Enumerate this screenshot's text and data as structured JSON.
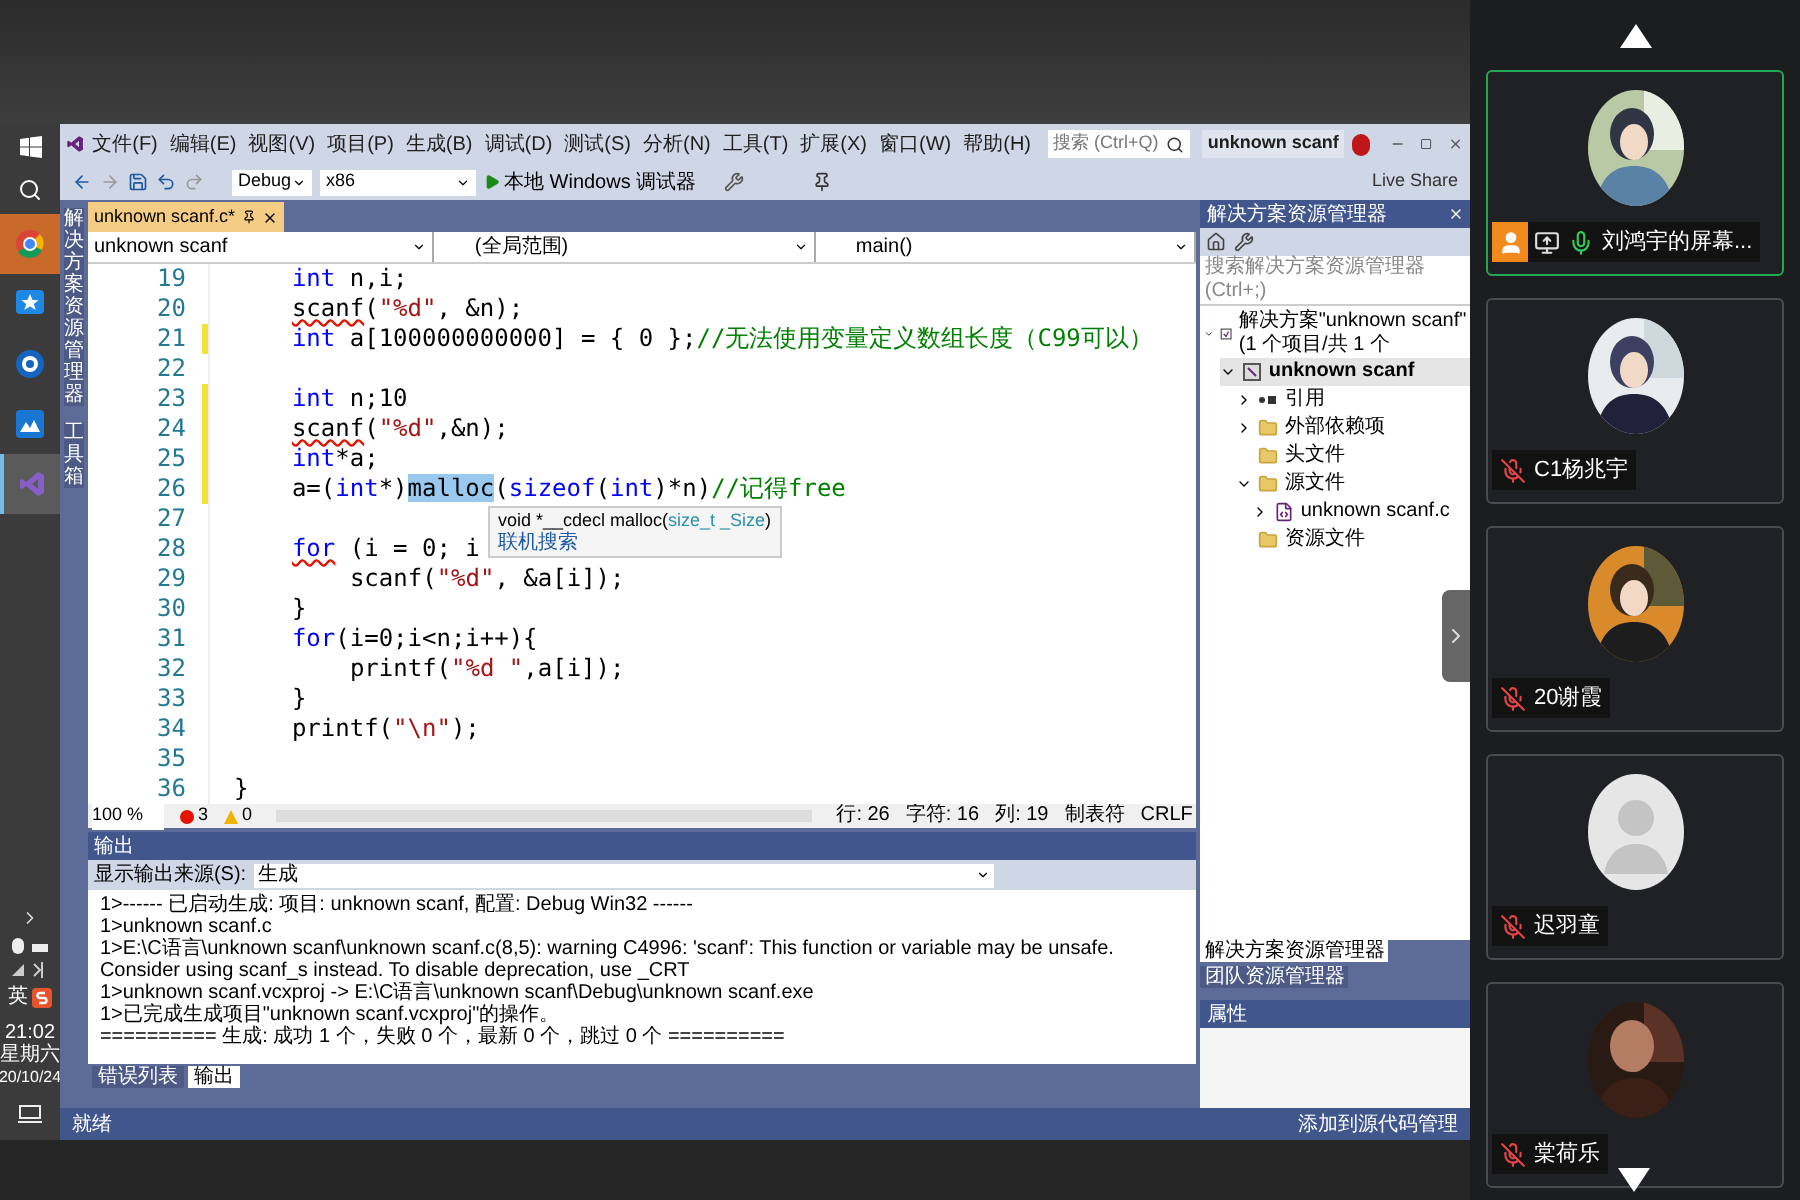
{
  "taskbar": {
    "ime": "英",
    "time": "21:02",
    "day": "星期六",
    "date": "20/10/24",
    "apps": [
      {
        "kind": "chrome",
        "selected": false
      },
      {
        "kind": "star",
        "selected": false
      },
      {
        "kind": "ring",
        "selected": false
      },
      {
        "kind": "mountain",
        "selected": false
      },
      {
        "kind": "vs",
        "selected": true
      }
    ]
  },
  "vs": {
    "menu": [
      "文件(F)",
      "编辑(E)",
      "视图(V)",
      "项目(P)",
      "生成(B)",
      "调试(D)",
      "测试(S)",
      "分析(N)",
      "工具(T)",
      "扩展(X)",
      "窗口(W)",
      "帮助(H)"
    ],
    "search": {
      "placeholder": "搜索 (Ctrl+Q)"
    },
    "title": "unknown scanf",
    "toolbar": {
      "config": "Debug",
      "platform": "x86",
      "run": "本地 Windows 调试器",
      "live_share": "Live Share"
    },
    "side_tabs": [
      "解决方案资源管理器",
      "工具箱"
    ],
    "doc_tab": {
      "label": "unknown scanf.c*"
    },
    "nav": [
      "unknown scanf",
      "(全局范围)",
      "main()"
    ],
    "code": [
      {
        "number": "19",
        "changed": false,
        "kind": "body",
        "tokens": [
          {
            "kind": "kw",
            "text": "int"
          },
          {
            "kind": "plain",
            "text": " n,i;"
          }
        ]
      },
      {
        "number": "20",
        "changed": false,
        "kind": "body",
        "tokens": [
          {
            "kind": "err",
            "text": "scanf"
          },
          {
            "kind": "plain",
            "text": "("
          },
          {
            "kind": "str",
            "text": "\"%d\""
          },
          {
            "kind": "plain",
            "text": ", &n);"
          }
        ]
      },
      {
        "number": "21",
        "changed": true,
        "kind": "body",
        "tokens": [
          {
            "kind": "kw",
            "text": "int"
          },
          {
            "kind": "plain",
            "text": " a[100000000000] = { 0 };"
          },
          {
            "kind": "cm",
            "text": "//无法使用变量定义数组长度（C99可以）"
          }
        ]
      },
      {
        "number": "22",
        "changed": false,
        "kind": "blank"
      },
      {
        "number": "23",
        "changed": true,
        "kind": "body",
        "tokens": [
          {
            "kind": "kw",
            "text": "int"
          },
          {
            "kind": "plain",
            "text": " n;10"
          }
        ]
      },
      {
        "number": "24",
        "changed": true,
        "kind": "body",
        "tokens": [
          {
            "kind": "err",
            "text": "scanf"
          },
          {
            "kind": "plain",
            "text": "("
          },
          {
            "kind": "str",
            "text": "\"%d\""
          },
          {
            "kind": "plain",
            "text": ",&n);"
          }
        ]
      },
      {
        "number": "25",
        "changed": true,
        "kind": "body",
        "tokens": [
          {
            "kind": "kw",
            "text": "int"
          },
          {
            "kind": "plain",
            "text": "*a;"
          }
        ]
      },
      {
        "number": "26",
        "changed": true,
        "kind": "body",
        "tokens": [
          {
            "kind": "plain",
            "text": "a=("
          },
          {
            "kind": "kw",
            "text": "int"
          },
          {
            "kind": "plain",
            "text": "*)"
          },
          {
            "kind": "hl",
            "text": "malloc"
          },
          {
            "kind": "plain",
            "text": "("
          },
          {
            "kind": "kw",
            "text": "sizeof"
          },
          {
            "kind": "plain",
            "text": "("
          },
          {
            "kind": "kw",
            "text": "int"
          },
          {
            "kind": "plain",
            "text": ")*n)"
          },
          {
            "kind": "cm",
            "text": "//记得free"
          }
        ]
      },
      {
        "number": "27",
        "changed": false,
        "kind": "blank"
      },
      {
        "number": "28",
        "changed": false,
        "kind": "body",
        "tokens": [
          {
            "kind": "kwerr",
            "text": "for"
          },
          {
            "kind": "plain",
            "text": " (i = 0; i"
          }
        ]
      },
      {
        "number": "29",
        "changed": false,
        "kind": "nested",
        "tokens": [
          {
            "kind": "plain",
            "text": "scanf("
          },
          {
            "kind": "str",
            "text": "\"%d\""
          },
          {
            "kind": "plain",
            "text": ", &a[i]);"
          }
        ]
      },
      {
        "number": "30",
        "changed": false,
        "kind": "body",
        "tokens": [
          {
            "kind": "plain",
            "text": "}"
          }
        ]
      },
      {
        "number": "31",
        "changed": false,
        "kind": "body",
        "tokens": [
          {
            "kind": "kw",
            "text": "for"
          },
          {
            "kind": "plain",
            "text": "(i=0;i<n;i++){"
          }
        ]
      },
      {
        "number": "32",
        "changed": false,
        "kind": "nested",
        "tokens": [
          {
            "kind": "plain",
            "text": "printf("
          },
          {
            "kind": "str",
            "text": "\"%d \""
          },
          {
            "kind": "plain",
            "text": ",a[i]);"
          }
        ]
      },
      {
        "number": "33",
        "changed": false,
        "kind": "body",
        "tokens": [
          {
            "kind": "plain",
            "text": "}"
          }
        ]
      },
      {
        "number": "34",
        "changed": false,
        "kind": "body",
        "tokens": [
          {
            "kind": "plain",
            "text": "printf("
          },
          {
            "kind": "str",
            "text": "\"\\n\""
          },
          {
            "kind": "plain",
            "text": ");"
          }
        ]
      },
      {
        "number": "35",
        "changed": false,
        "kind": "blank"
      },
      {
        "number": "36",
        "changed": false,
        "kind": "top",
        "tokens": [
          {
            "kind": "plain",
            "text": "}"
          }
        ]
      }
    ],
    "tooltip": {
      "prefix": "void *__cdecl malloc(",
      "param": "size_t _Size",
      "suffix": ")",
      "link": "联机搜索"
    },
    "editor_status": {
      "zoom": "100 %",
      "errors": "3",
      "warnings": "0",
      "position": [
        "行: 26",
        "字符: 16",
        "列: 19",
        "制表符",
        "CRLF"
      ]
    },
    "output": {
      "title": "输出",
      "source_label": "显示输出来源(S):",
      "source": "生成",
      "lines": [
        "1>------ 已启动生成: 项目: unknown scanf, 配置: Debug Win32 ------",
        "1>unknown scanf.c",
        "1>E:\\C语言\\unknown scanf\\unknown scanf.c(8,5): warning C4996: 'scanf': This function or variable may be unsafe. Consider using scanf_s instead. To disable deprecation, use _CRT",
        "1>unknown scanf.vcxproj -> E:\\C语言\\unknown scanf\\Debug\\unknown scanf.exe",
        "1>已完成生成项目\"unknown scanf.vcxproj\"的操作。",
        "========== 生成: 成功 1 个，失败 0 个，最新 0 个，跳过 0 个 =========="
      ],
      "tabs": [
        {
          "label": "错误列表",
          "selected": false
        },
        {
          "label": "输出",
          "selected": true
        }
      ]
    },
    "status": {
      "text": "就绪",
      "scm": "添加到源代码管理"
    },
    "solution": {
      "title": "解决方案资源管理器",
      "search": {
        "placeholder": "搜索解决方案资源管理器(Ctrl+;)"
      },
      "tree": [
        {
          "label": "解决方案\"unknown scanf\"(1 个项目/共 1 个",
          "kind": "solution",
          "expanded": true,
          "children": [
            {
              "label": "unknown scanf",
              "kind": "project",
              "expanded": true,
              "children": [
                {
                  "label": "引用",
                  "kind": "refs",
                  "expanded": false
                },
                {
                  "label": "外部依赖项",
                  "kind": "folder",
                  "expanded": false
                },
                {
                  "label": "头文件",
                  "kind": "folder"
                },
                {
                  "label": "源文件",
                  "kind": "folder",
                  "expanded": true,
                  "children": [
                    {
                      "label": "unknown scanf.c",
                      "kind": "file",
                      "expanded": false
                    }
                  ]
                },
                {
                  "label": "资源文件",
                  "kind": "folder"
                }
              ]
            }
          ]
        }
      ],
      "tabs": [
        {
          "label": "解决方案资源管理器",
          "selected": true
        },
        {
          "label": "团队资源管理器",
          "selected": false
        }
      ],
      "properties": "属性"
    }
  },
  "participants": [
    {
      "name": "刘鸿宇的屏幕...",
      "kind": "picture",
      "muted": false,
      "sharing": true,
      "selected": true
    },
    {
      "name": "C1杨兆宇",
      "kind": "picture",
      "muted": true,
      "sharing": false,
      "selected": false
    },
    {
      "name": "20谢霞",
      "kind": "picture",
      "muted": true,
      "sharing": false,
      "selected": false
    },
    {
      "name": "迟羽童",
      "kind": "silhouette",
      "muted": true,
      "sharing": false,
      "selected": false
    },
    {
      "name": "棠荷乐",
      "kind": "picture",
      "muted": true,
      "sharing": false,
      "selected": false
    }
  ]
}
